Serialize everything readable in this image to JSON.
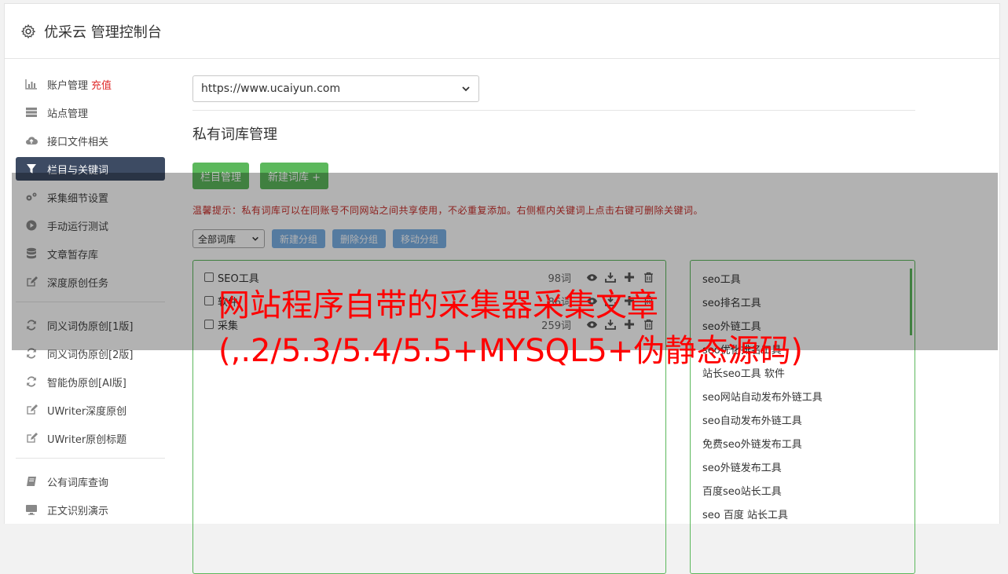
{
  "header": {
    "title": "优采云 管理控制台",
    "icon": "gear-icon"
  },
  "sidebar": {
    "group1": [
      {
        "label": "账户管理",
        "extra": "充值",
        "icon": "bar-chart-icon"
      },
      {
        "label": "站点管理",
        "icon": "server-icon"
      },
      {
        "label": "接口文件相关",
        "icon": "cloud-upload-icon"
      },
      {
        "label": "栏目与关键词",
        "icon": "filter-icon",
        "active": true
      },
      {
        "label": "采集细节设置",
        "icon": "gears-icon"
      },
      {
        "label": "手动运行测试",
        "icon": "play-circle-icon"
      },
      {
        "label": "文章暂存库",
        "icon": "database-icon"
      },
      {
        "label": "深度原创任务",
        "icon": "edit-icon"
      }
    ],
    "group2": [
      {
        "label": "同义词伪原创[1版]",
        "icon": "refresh-icon"
      },
      {
        "label": "同义词伪原创[2版]",
        "icon": "refresh-icon"
      },
      {
        "label": "智能伪原创[AI版]",
        "icon": "refresh-icon"
      },
      {
        "label": "UWriter深度原创",
        "icon": "edit-icon"
      },
      {
        "label": "UWriter原创标题",
        "icon": "edit-icon"
      }
    ],
    "group3": [
      {
        "label": "公有词库查询",
        "icon": "book-icon"
      },
      {
        "label": "正文识别演示",
        "icon": "monitor-icon"
      }
    ]
  },
  "main": {
    "site_select": "https://www.ucaiyun.com",
    "title": "私有词库管理",
    "btn_columns": "栏目管理",
    "btn_new_lib": "新建词库 +",
    "tip": "温馨提示：私有词库可以在同账号不同网站之间共享使用，不必重复添加。右侧框内关键词上点击右键可删除关键词。",
    "filter_select": "全部词库",
    "btn_new_group": "新建分组",
    "btn_delete_group": "删除分组",
    "btn_move_group": "移动分组"
  },
  "libraries": [
    {
      "name": "SEO工具",
      "count": "98词"
    },
    {
      "name": "软件",
      "count": "86词"
    },
    {
      "name": "采集",
      "count": "259词"
    }
  ],
  "keywords": [
    "seo工具",
    "seo排名工具",
    "seo外链工具",
    "seo优化排名工具",
    "站长seo工具 软件",
    "seo网站自动发布外链工具",
    "seo自动发布外链工具",
    "免费seo外链发布工具",
    "seo外链发布工具",
    "百度seo站长工具",
    "seo 百度 站长工具"
  ],
  "overlay_text": "网站程序自带的采集器采集文章(,.2/5.3/5.4/5.5+MYSQL5+伪静态源码)",
  "colors": {
    "accent_green": "#5cb85c",
    "active_nav": "#3d4b63",
    "tip_red": "#c9302c",
    "overlay_red": "#ff0000"
  }
}
